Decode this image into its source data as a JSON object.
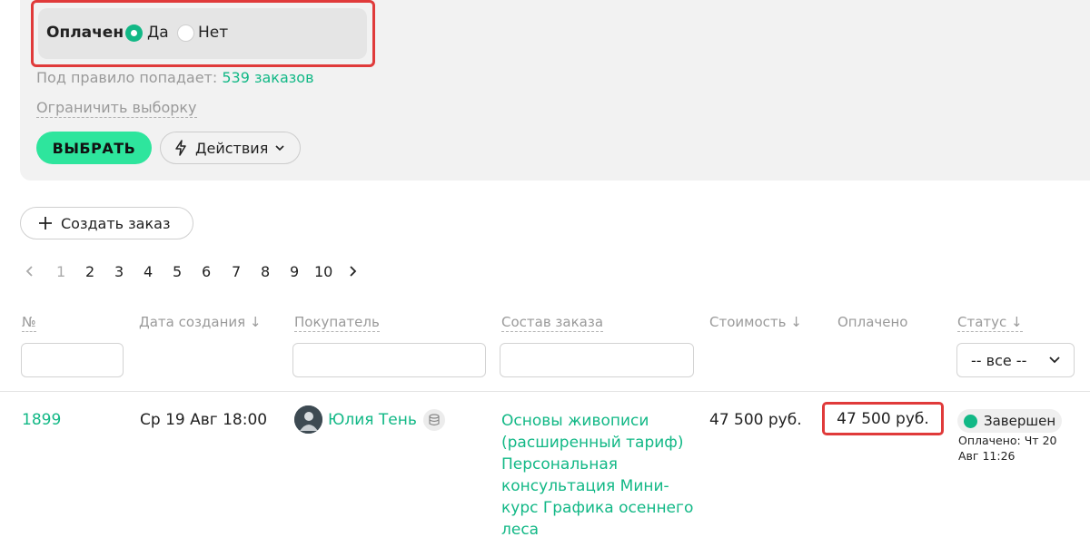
{
  "colors": {
    "accent": "#12b886",
    "button_green": "#2ee59d",
    "highlight_red": "#e03a3a"
  },
  "filter": {
    "paid_label": "Оплачен",
    "options": [
      "Да",
      "Нет"
    ],
    "selected": "Да",
    "rule_prefix": "Под правило попадает:",
    "rule_count": "539 заказов",
    "limit_link": "Ограничить выборку",
    "select_button": "ВЫБРАТЬ",
    "actions_button": "Действия"
  },
  "create_order": "Создать заказ",
  "pagination": {
    "pages": [
      "1",
      "2",
      "3",
      "4",
      "5",
      "6",
      "7",
      "8",
      "9",
      "10"
    ],
    "current": "1"
  },
  "table": {
    "headers": [
      "№",
      "Дата создания ↓",
      "Покупатель",
      "Состав заказа",
      "Стоимость ↓",
      "Оплачено",
      "Статус ↓"
    ],
    "status_filter_value": "-- все --",
    "rows": [
      {
        "number": "1899",
        "created": "Ср 19 Авг 18:00",
        "buyer": "Юлия Тень",
        "composition": "Основы живописи (расширенный тариф) Персональная консультация Мини-курс Графика осеннего леса",
        "cost": "47 500 руб.",
        "paid": "47 500 руб.",
        "status": "Завершен",
        "paid_at": "Оплачено: Чт 20 Авг 11:26"
      }
    ]
  }
}
